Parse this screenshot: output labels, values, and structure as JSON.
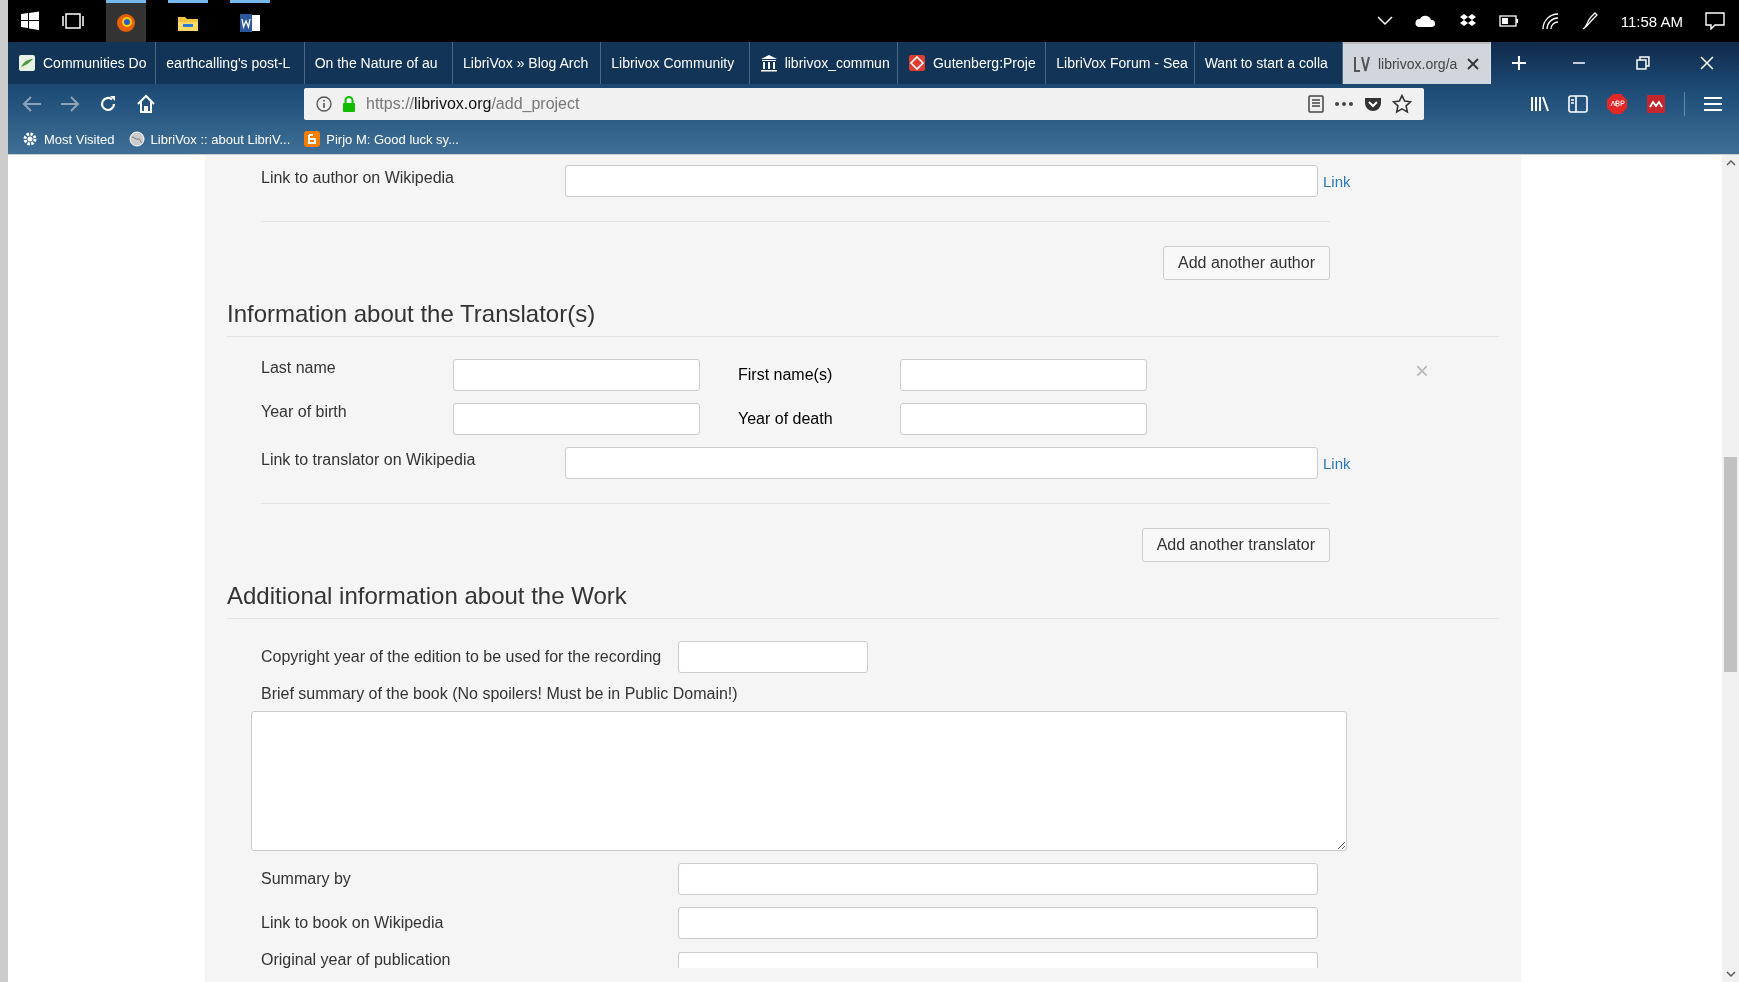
{
  "taskbar": {
    "clock": "11:58 AM"
  },
  "tabs": [
    {
      "title": "Communities Do",
      "kind": "page",
      "selected": false
    },
    {
      "title": "earthcalling's post-L",
      "kind": "plain",
      "selected": false
    },
    {
      "title": "On the Nature of au",
      "kind": "plain",
      "selected": false
    },
    {
      "title": "LibriVox » Blog Arch",
      "kind": "plain",
      "selected": false
    },
    {
      "title": "Librivox Community",
      "kind": "plain",
      "selected": false
    },
    {
      "title": "librivox_commun",
      "kind": "columns",
      "selected": false
    },
    {
      "title": "Gutenberg:Proje",
      "kind": "diamond",
      "selected": false
    },
    {
      "title": "LibriVox Forum - Sea",
      "kind": "plain",
      "selected": false
    },
    {
      "title": "Want to start a colla",
      "kind": "plain",
      "selected": false
    },
    {
      "title": "librivox.org/a",
      "kind": "letters",
      "selected": true
    }
  ],
  "address_bar": {
    "scheme": "https://",
    "domain": "librivox.org",
    "path": "/add_project"
  },
  "bookmarks": [
    {
      "label": "Most Visited"
    },
    {
      "label": "LibriVox :: about LibriV..."
    },
    {
      "label": "Pirjo M: Good luck sy..."
    }
  ],
  "author_section": {
    "wiki_label": "Link to author on Wikipedia",
    "wiki_link": "Link",
    "add_button": "Add another author"
  },
  "translator_section": {
    "heading": "Information about the Translator(s)",
    "last_name": "Last name",
    "first_names": "First name(s)",
    "year_birth": "Year of birth",
    "year_death": "Year of death",
    "wiki_label": "Link to translator on Wikipedia",
    "wiki_link": "Link",
    "remove_icon": "×",
    "add_button": "Add another translator"
  },
  "work_section": {
    "heading": "Additional information about the Work",
    "copyright_label": "Copyright year of the edition to be used for the recording",
    "summary_label": "Brief summary of the book (No spoilers! Must be in Public Domain!)",
    "summary_by": "Summary by",
    "wiki_label": "Link to book on Wikipedia",
    "original_year": "Original year of publication"
  }
}
